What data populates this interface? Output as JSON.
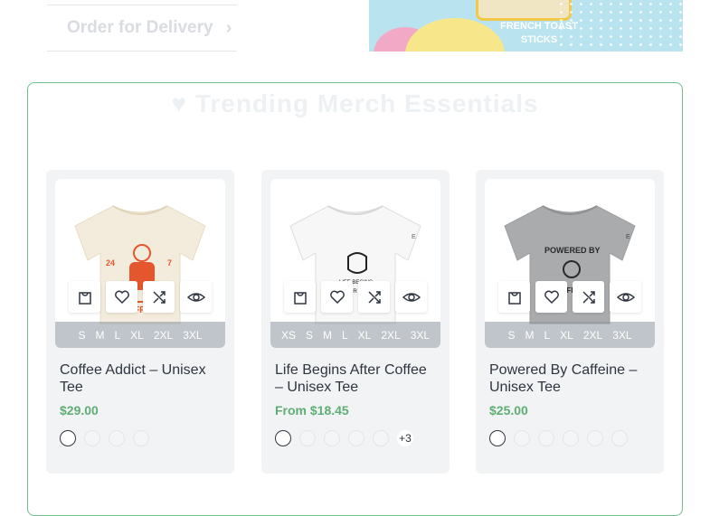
{
  "top": {
    "order_link": "Order for Delivery",
    "banner_label_line1": "FRENCH TOAST",
    "banner_label_line2": "STICKS"
  },
  "section": {
    "title": "Trending Merch Essentials"
  },
  "products": [
    {
      "name": "Coffee Addict – Unisex Tee",
      "price": "$29.00",
      "sizes": [
        "S",
        "M",
        "L",
        "XL",
        "2XL",
        "3XL"
      ],
      "tee_color": "#f3ecdc",
      "print_color": "#e4572e",
      "swatch_count": 4,
      "more": ""
    },
    {
      "name": "Life Begins After Coffee – Unisex Tee",
      "price": "From $18.45",
      "sizes": [
        "XS",
        "S",
        "M",
        "L",
        "XL",
        "2XL",
        "3XL"
      ],
      "tee_color": "#f7f7f7",
      "print_color": "#222222",
      "swatch_count": 5,
      "more": "+3"
    },
    {
      "name": "Powered By Caffeine – Unisex Tee",
      "price": "$25.00",
      "sizes": [
        "S",
        "M",
        "L",
        "XL",
        "2XL",
        "3XL"
      ],
      "tee_color": "#a9abad",
      "print_color": "#2a2a2a",
      "swatch_count": 6,
      "more": ""
    }
  ],
  "colors": {
    "accent_green": "#5fae73",
    "border_green": "#6fc18a"
  },
  "icons": [
    "bag-icon",
    "heart-icon",
    "compare-icon",
    "eye-icon",
    "chevron-right-icon"
  ]
}
